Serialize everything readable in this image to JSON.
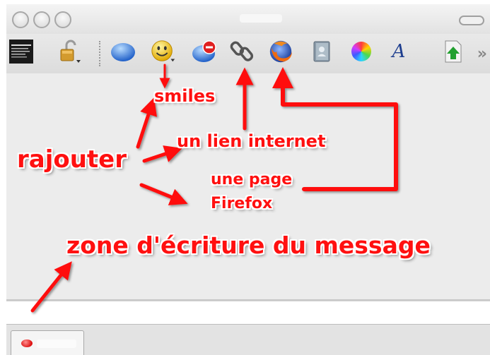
{
  "window": {
    "buttons": [
      "close",
      "minimize",
      "zoom"
    ]
  },
  "toolbar": {
    "items": [
      {
        "name": "buddy-picture-icon"
      },
      {
        "name": "lock-icon"
      },
      {
        "name": "blue-bubble-icon"
      },
      {
        "name": "smiley-icon"
      },
      {
        "name": "block-icon"
      },
      {
        "name": "link-icon"
      },
      {
        "name": "firefox-icon"
      },
      {
        "name": "contacts-book-icon"
      },
      {
        "name": "color-wheel-icon"
      },
      {
        "name": "font-icon",
        "glyph": "A"
      },
      {
        "name": "send-file-icon"
      }
    ],
    "overflow": "»"
  },
  "annotations": {
    "smiles": "smiles",
    "lien": "un lien internet",
    "rajouter": "rajouter",
    "page_line1": "une page",
    "page_line2": "Firefox",
    "zone": "zone d'écriture du message"
  },
  "colors": {
    "annotation": "#ff1010",
    "window_bg": "#ececec"
  }
}
